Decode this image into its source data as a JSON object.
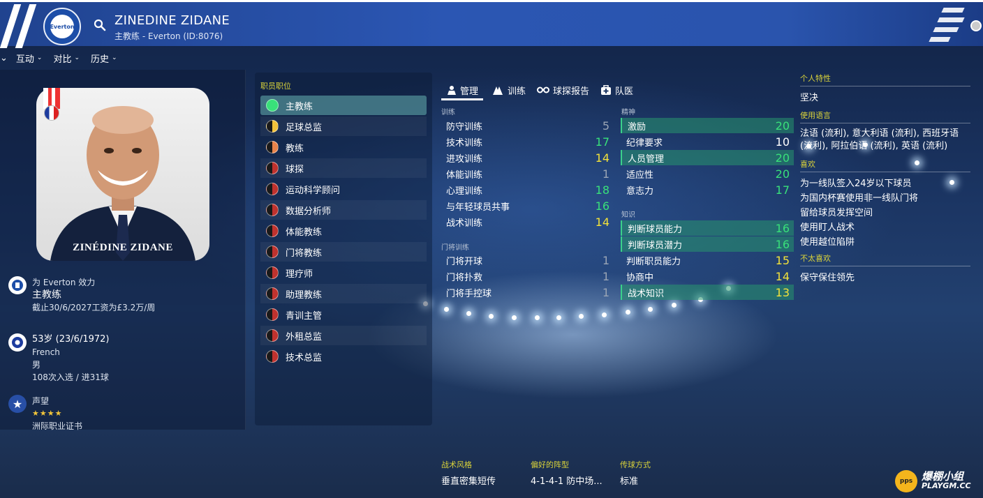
{
  "header": {
    "club_crest": "Everton",
    "name": "ZINEDINE ZIDANE",
    "subtitle": "主教练 - Everton (ID:8076)"
  },
  "menu": [
    {
      "label": "互动"
    },
    {
      "label": "对比"
    },
    {
      "label": "历史"
    }
  ],
  "profile": {
    "photo_name": "ZINÉDINE ZIDANE",
    "club_line": "为 Everton 效力",
    "role": "主教练",
    "contract": "截止30/6/2027工资为£3.2万/周",
    "age_dob": "53岁 (23/6/1972)",
    "nationality": "French",
    "gender": "男",
    "caps": "108次入选 / 进31球",
    "reputation_label": "声望",
    "reputation_stars": 4,
    "stars_text": "★★★★",
    "license": "洲际职业证书"
  },
  "roles": {
    "heading": "职员职位",
    "items": [
      {
        "label": "主教练",
        "color": "#39e07a"
      },
      {
        "label": "足球总监",
        "color": "#f3c23a"
      },
      {
        "label": "教练",
        "color": "#e8834a"
      },
      {
        "label": "球探",
        "color": "#c0322e"
      },
      {
        "label": "运动科学顾问",
        "color": "#c0322e"
      },
      {
        "label": "数据分析师",
        "color": "#c0322e"
      },
      {
        "label": "体能教练",
        "color": "#c0322e"
      },
      {
        "label": "门将教练",
        "color": "#c0322e"
      },
      {
        "label": "理疗师",
        "color": "#c0322e"
      },
      {
        "label": "助理教练",
        "color": "#c0322e"
      },
      {
        "label": "青训主管",
        "color": "#c0322e"
      },
      {
        "label": "外租总监",
        "color": "#c0322e"
      },
      {
        "label": "技术总监",
        "color": "#c0322e"
      }
    ]
  },
  "tabs": [
    {
      "label": "管理",
      "icon": "coach-icon"
    },
    {
      "label": "训练",
      "icon": "training-icon"
    },
    {
      "label": "球探报告",
      "icon": "binoculars-icon"
    },
    {
      "label": "队医",
      "icon": "medical-kit-icon"
    }
  ],
  "attributes": {
    "training_label": "训练",
    "training": [
      {
        "label": "防守训练",
        "value": "5"
      },
      {
        "label": "技术训练",
        "value": "17"
      },
      {
        "label": "进攻训练",
        "value": "14"
      },
      {
        "label": "体能训练",
        "value": "1"
      },
      {
        "label": "心理训练",
        "value": "18"
      },
      {
        "label": "与年轻球员共事",
        "value": "16"
      },
      {
        "label": "战术训练",
        "value": "14"
      }
    ],
    "gk_label": "门将训练",
    "gk": [
      {
        "label": "门将开球",
        "value": "1"
      },
      {
        "label": "门将扑救",
        "value": "1"
      },
      {
        "label": "门将手控球",
        "value": "1"
      }
    ],
    "mental_label": "精神",
    "mental": [
      {
        "label": "激励",
        "value": "20"
      },
      {
        "label": "纪律要求",
        "value": "10"
      },
      {
        "label": "人员管理",
        "value": "20"
      },
      {
        "label": "适应性",
        "value": "20"
      },
      {
        "label": "意志力",
        "value": "17"
      }
    ],
    "knowledge_label": "知识",
    "knowledge": [
      {
        "label": "判断球员能力",
        "value": "16"
      },
      {
        "label": "判断球员潜力",
        "value": "16"
      },
      {
        "label": "判断职员能力",
        "value": "15"
      },
      {
        "label": "协商中",
        "value": "14"
      },
      {
        "label": "战术知识",
        "value": "13"
      }
    ]
  },
  "right": {
    "traits_label": "个人特性",
    "trait": "坚决",
    "languages_label": "使用语言",
    "languages": "法语 (流利), 意大利语 (流利), 西班牙语 (流利), 阿拉伯语 (流利), 英语 (流利)",
    "likes_label": "喜欢",
    "likes": [
      "为一线队签入24岁以下球员",
      "为国内杯赛使用非一线队门将",
      "留给球员发挥空间",
      "使用盯人战术",
      "使用越位陷阱"
    ],
    "dislikes_label": "不太喜欢",
    "dislikes": [
      "保守保住领先"
    ]
  },
  "bottom": {
    "style_label": "战术风格",
    "style_value": "垂直密集短传",
    "formation_label": "偏好的阵型",
    "formation_value": "4-1-4-1 防中场...",
    "passing_label": "传球方式",
    "passing_value": "标准"
  },
  "watermark": {
    "logo": "pps",
    "line1": "爆棚小组",
    "line2": "PLAYGM.CC"
  }
}
